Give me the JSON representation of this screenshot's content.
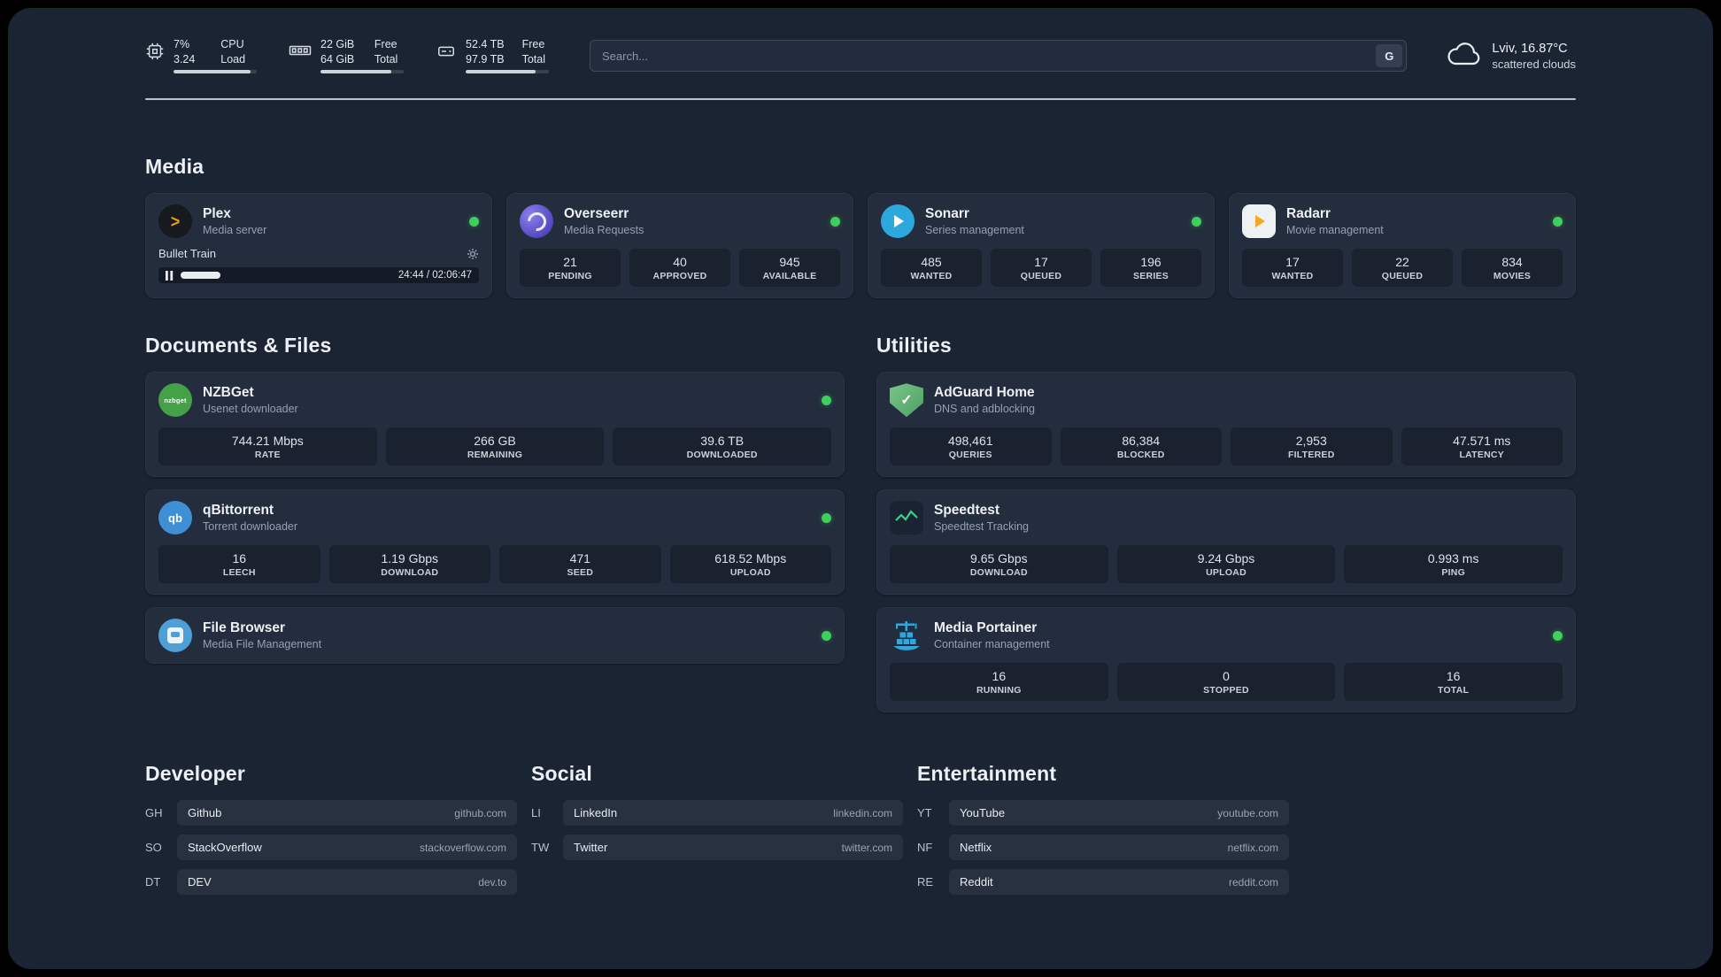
{
  "topbar": {
    "cpu": {
      "value_top": "7%",
      "value_bottom": "3.24",
      "label_top": "CPU",
      "label_bottom": "Load",
      "bar_percent": 93
    },
    "ram": {
      "value_top": "22 GiB",
      "value_bottom": "64 GiB",
      "label_top": "Free",
      "label_bottom": "Total",
      "bar_percent": 85
    },
    "disk": {
      "value_top": "52.4 TB",
      "value_bottom": "97.9 TB",
      "label_top": "Free",
      "label_bottom": "Total",
      "bar_percent": 84
    },
    "search": {
      "placeholder": "Search...",
      "engine_label": "G"
    },
    "weather": {
      "location": "Lviv, 16.87°C",
      "condition": "scattered clouds"
    }
  },
  "sections": {
    "media": "Media",
    "documents": "Documents & Files",
    "utilities": "Utilities"
  },
  "media_cards": [
    {
      "id": "plex",
      "title": "Plex",
      "subtitle": "Media server",
      "status": true,
      "icon_glyph": ">",
      "player": {
        "track": "Bullet Train",
        "time": "24:44 / 02:06:47",
        "progress_percent": 19
      }
    },
    {
      "id": "overseerr",
      "title": "Overseerr",
      "subtitle": "Media Requests",
      "status": true,
      "icon_glyph": "",
      "stats": [
        {
          "value": "21",
          "label": "PENDING"
        },
        {
          "value": "40",
          "label": "APPROVED"
        },
        {
          "value": "945",
          "label": "AVAILABLE"
        }
      ]
    },
    {
      "id": "sonarr",
      "title": "Sonarr",
      "subtitle": "Series management",
      "status": true,
      "icon_glyph": "",
      "stats": [
        {
          "value": "485",
          "label": "WANTED"
        },
        {
          "value": "17",
          "label": "QUEUED"
        },
        {
          "value": "196",
          "label": "SERIES"
        }
      ]
    },
    {
      "id": "radarr",
      "title": "Radarr",
      "subtitle": "Movie management",
      "status": true,
      "icon_glyph": "",
      "stats": [
        {
          "value": "17",
          "label": "WANTED"
        },
        {
          "value": "22",
          "label": "QUEUED"
        },
        {
          "value": "834",
          "label": "MOVIES"
        }
      ]
    }
  ],
  "documents_cards": [
    {
      "id": "nzbget",
      "title": "NZBGet",
      "subtitle": "Usenet downloader",
      "status": true,
      "icon_glyph": "nzbget",
      "stats": [
        {
          "value": "744.21 Mbps",
          "label": "RATE"
        },
        {
          "value": "266 GB",
          "label": "REMAINING"
        },
        {
          "value": "39.6 TB",
          "label": "DOWNLOADED"
        }
      ]
    },
    {
      "id": "qbittorrent",
      "title": "qBittorrent",
      "subtitle": "Torrent downloader",
      "status": true,
      "icon_glyph": "qb",
      "stats": [
        {
          "value": "16",
          "label": "LEECH"
        },
        {
          "value": "1.19 Gbps",
          "label": "DOWNLOAD"
        },
        {
          "value": "471",
          "label": "SEED"
        },
        {
          "value": "618.52 Mbps",
          "label": "UPLOAD"
        }
      ]
    },
    {
      "id": "filebrowser",
      "title": "File Browser",
      "subtitle": "Media File Management",
      "status": true,
      "icon_glyph": ""
    }
  ],
  "utilities_cards": [
    {
      "id": "adguard",
      "title": "AdGuard Home",
      "subtitle": "DNS and adblocking",
      "status": false,
      "icon_glyph": "✓",
      "stats": [
        {
          "value": "498,461",
          "label": "QUERIES"
        },
        {
          "value": "86,384",
          "label": "BLOCKED"
        },
        {
          "value": "2,953",
          "label": "FILTERED"
        },
        {
          "value": "47.571 ms",
          "label": "LATENCY"
        }
      ]
    },
    {
      "id": "speedtest",
      "title": "Speedtest",
      "subtitle": "Speedtest Tracking",
      "status": false,
      "icon_glyph": "",
      "stats": [
        {
          "value": "9.65 Gbps",
          "label": "DOWNLOAD"
        },
        {
          "value": "9.24 Gbps",
          "label": "UPLOAD"
        },
        {
          "value": "0.993 ms",
          "label": "PING"
        }
      ]
    },
    {
      "id": "portainer",
      "title": "Media Portainer",
      "subtitle": "Container management",
      "status": true,
      "icon_glyph": "",
      "stats": [
        {
          "value": "16",
          "label": "RUNNING"
        },
        {
          "value": "0",
          "label": "STOPPED"
        },
        {
          "value": "16",
          "label": "TOTAL"
        }
      ]
    }
  ],
  "bookmark_groups": [
    {
      "title": "Developer",
      "items": [
        {
          "abbr": "GH",
          "name": "Github",
          "url": "github.com"
        },
        {
          "abbr": "SO",
          "name": "StackOverflow",
          "url": "stackoverflow.com"
        },
        {
          "abbr": "DT",
          "name": "DEV",
          "url": "dev.to"
        }
      ]
    },
    {
      "title": "Social",
      "items": [
        {
          "abbr": "LI",
          "name": "LinkedIn",
          "url": "linkedin.com"
        },
        {
          "abbr": "TW",
          "name": "Twitter",
          "url": "twitter.com"
        }
      ]
    },
    {
      "title": "Entertainment",
      "items": [
        {
          "abbr": "YT",
          "name": "YouTube",
          "url": "youtube.com"
        },
        {
          "abbr": "NF",
          "name": "Netflix",
          "url": "netflix.com"
        },
        {
          "abbr": "RE",
          "name": "Reddit",
          "url": "reddit.com"
        }
      ]
    }
  ],
  "colors": {
    "background": "#1b2433",
    "card": "#232d3d",
    "tile": "#1a2230",
    "accent_green": "#3ecf5c"
  }
}
